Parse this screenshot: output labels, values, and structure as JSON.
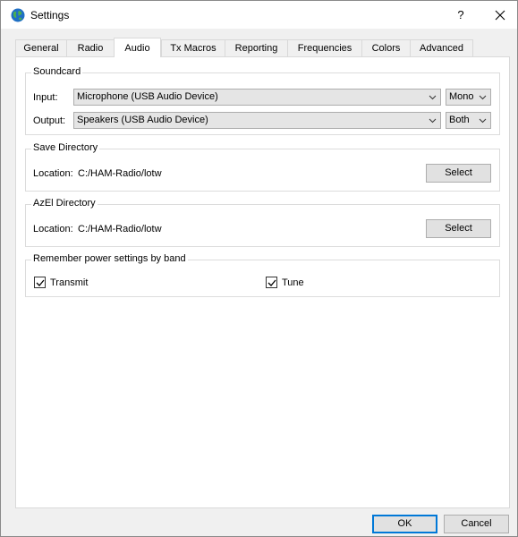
{
  "window": {
    "title": "Settings",
    "help_label": "?"
  },
  "tabs": [
    {
      "label": "General"
    },
    {
      "label": "Radio"
    },
    {
      "label": "Audio",
      "active": true
    },
    {
      "label": "Tx Macros"
    },
    {
      "label": "Reporting"
    },
    {
      "label": "Frequencies"
    },
    {
      "label": "Colors"
    },
    {
      "label": "Advanced"
    }
  ],
  "soundcard": {
    "title": "Soundcard",
    "input_label": "Input:",
    "input_device": "Microphone (USB Audio Device)",
    "input_channel": "Mono",
    "output_label": "Output:",
    "output_device": "Speakers (USB Audio Device)",
    "output_channel": "Both"
  },
  "save_directory": {
    "title": "Save Directory",
    "location_label": "Location:",
    "path": "C:/HAM-Radio/lotw",
    "select_label": "Select"
  },
  "azel_directory": {
    "title": "AzEl Directory",
    "location_label": "Location:",
    "path": "C:/HAM-Radio/lotw",
    "select_label": "Select"
  },
  "power_settings": {
    "title": "Remember power settings by band",
    "transmit_label": "Transmit",
    "transmit_checked": true,
    "tune_label": "Tune",
    "tune_checked": true
  },
  "footer": {
    "ok_label": "OK",
    "cancel_label": "Cancel"
  },
  "icons": {
    "app": "globe-icon",
    "close": "close-icon",
    "dropdown": "chevron-down-icon",
    "check": "checkmark-icon"
  },
  "colors": {
    "accent": "#0078d7"
  }
}
